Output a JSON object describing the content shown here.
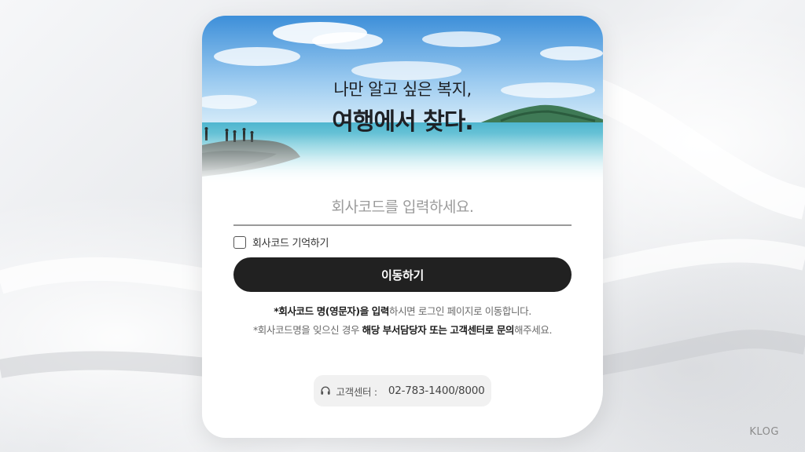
{
  "hero": {
    "line1": "나만 알고 싶은 복지,",
    "line2": "여행에서 찾다."
  },
  "form": {
    "code_placeholder": "회사코드를 입력하세요.",
    "code_value": "",
    "remember_label": "회사코드 기억하기",
    "remember_checked": false,
    "submit_label": "이동하기"
  },
  "notes": {
    "line1_bold": "*회사코드 명(영문자)을 입력",
    "line1_rest": "하시면 로그인 페이지로 이동합니다.",
    "line2_pre": "*회사코드명을 잊으신 경우 ",
    "line2_bold": "해당 부서담당자 또는 고객센터로 문의",
    "line2_post": "해주세요."
  },
  "support": {
    "icon": "headset-icon",
    "label": "고객센터 :",
    "phone": "02-783-1400/8000"
  },
  "brand": {
    "name": "KLOG"
  },
  "colors": {
    "button_bg": "#212121",
    "sky_top": "#3d8fd9",
    "sea": "#5fc2d6"
  }
}
